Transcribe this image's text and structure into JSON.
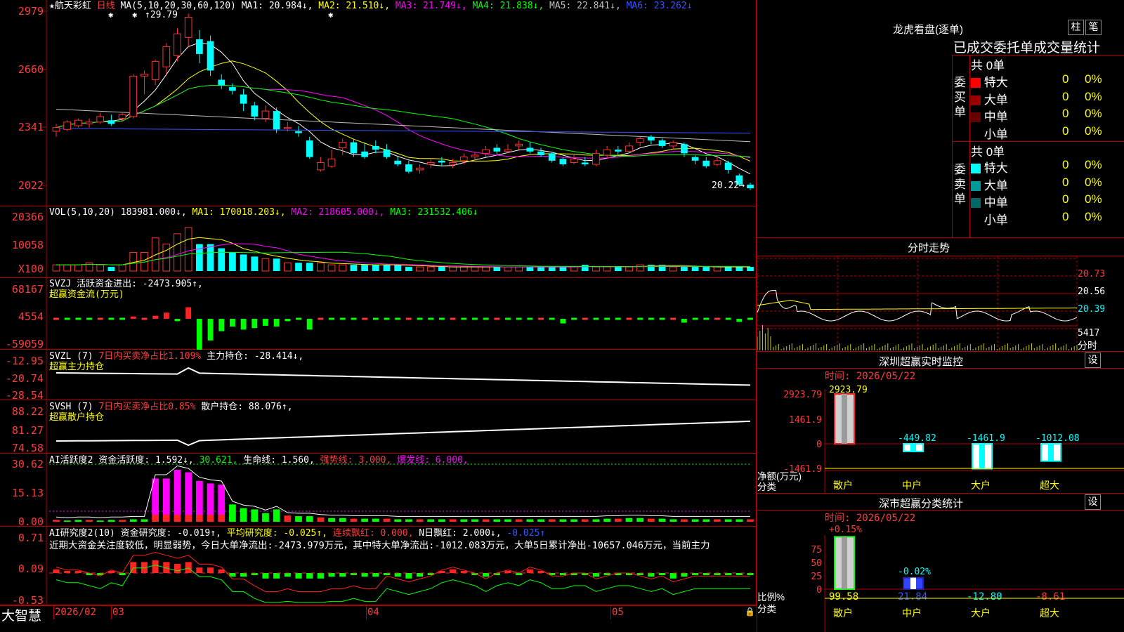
{
  "stock": {
    "star": "★",
    "name": "航天彩虹",
    "period": "日线"
  },
  "main_panel": {
    "ma_params": "MA(5,10,20,30,60,120)",
    "ma_values": [
      {
        "label": "MA1: 20.984↓,",
        "color": "#ffffff"
      },
      {
        "label": "MA2: 21.510↓,",
        "color": "#ffff00"
      },
      {
        "label": "MA3: 21.749↓,",
        "color": "#ff00ff"
      },
      {
        "label": "MA4: 21.838↓,",
        "color": "#00ff00"
      },
      {
        "label": "MA5: 22.841↓,",
        "color": "#c0c0c0"
      },
      {
        "label": "MA6: 23.262↓",
        "color": "#3355ff"
      }
    ],
    "high_label": "29.79",
    "low_label": "20.22",
    "y_ticks": [
      "2979",
      "2660",
      "2341",
      "2022"
    ]
  },
  "vol_panel": {
    "title": "VOL(5,10,20)",
    "value": "183981.000↓,",
    "ma1": "MA1: 170018.203↓,",
    "ma2": "MA2: 218605.000↓,",
    "ma3": "MA3: 231532.406↓",
    "y_ticks": [
      "20366",
      "10058"
    ],
    "unit": "X100"
  },
  "svzj_panel": {
    "title": "SVZJ  活跃资金进出: -2473.905↑,",
    "subtitle": "超赢资金流(万元)",
    "y_ticks": [
      "68167",
      "4554",
      "-59059"
    ]
  },
  "svzl_panel": {
    "prefix": "SVZL (7)",
    "ratio": "7日内买卖净占比1.109%",
    "hold": "主力持仓: -28.414↓,",
    "subtitle": "超赢主力持仓",
    "y_ticks": [
      "-12.95",
      "-20.74",
      "-28.54"
    ]
  },
  "svsh_panel": {
    "prefix": "SVSH (7)",
    "ratio": "7日内买卖净占比0.85%",
    "hold": "散户持仓: 88.076↑,",
    "subtitle": "超赢散户持仓",
    "y_ticks": [
      "88.22",
      "81.27",
      "74.58"
    ]
  },
  "ai_active_panel": {
    "prefix": "AI活跃度2",
    "activity": "资金活跃度: 1.592↓,",
    "v2": "30.621,",
    "life": "生命线: 1.560,",
    "strong": "强势线: 3.000,",
    "burst": "爆发线: 6.000,",
    "y_ticks": [
      "30.62",
      "15.13",
      "0.00"
    ]
  },
  "ai_research_panel": {
    "prefix": "AI研究度2(10)",
    "research": "资金研究度: -0.019↑,",
    "avg": "平均研究度: -0.025↑,",
    "red1": "连续飘红: 0.000,",
    "red2": "N日飘红: 2.000↓,",
    "last": "-0.025↑",
    "text": "近期大资金关注度较低，明显弱势，今日大单净流出:-2473.979万元，其中特大单净流出:-1012.083万元，大单5日累计净出-10657.046万元，当前主力",
    "y_ticks": [
      "0.71",
      "0.09",
      "-0.53"
    ]
  },
  "x_axis": {
    "labels": [
      "2026/02",
      "03",
      "04",
      "05"
    ]
  },
  "brand": "大智慧",
  "right": {
    "dragon_title": "龙虎看盘(逐单)",
    "btn_zhu": "柱",
    "btn_bi": "笔",
    "stats_title": "已成交委托单成交量统计",
    "buy_label": "委买单",
    "sell_label": "委卖单",
    "buy_total": "共 0单",
    "sell_total": "共 0单",
    "buy_rows": [
      {
        "name": "特大",
        "count": "0",
        "pct": "0%",
        "color": "#ff0000"
      },
      {
        "name": "大单",
        "count": "0",
        "pct": "0%",
        "color": "#990000"
      },
      {
        "name": "中单",
        "count": "0",
        "pct": "0%",
        "color": "#660000"
      },
      {
        "name": "小单",
        "count": "0",
        "pct": "0%",
        "color": "#000000"
      }
    ],
    "sell_rows": [
      {
        "name": "特大",
        "count": "0",
        "pct": "0%",
        "color": "#00ffff"
      },
      {
        "name": "大单",
        "count": "0",
        "pct": "0%",
        "color": "#009999"
      },
      {
        "name": "中单",
        "count": "0",
        "pct": "0%",
        "color": "#006666"
      },
      {
        "name": "小单",
        "count": "0",
        "pct": "0%",
        "color": "#000000"
      }
    ],
    "intraday_title": "分时走势",
    "intraday_ticks": [
      "20.73",
      "20.56",
      "20.39"
    ],
    "intraday_vol": "5417",
    "intraday_label": "分时",
    "monitor_title": "深圳超赢实时监控",
    "monitor_btn": "设",
    "monitor_time": "时间: 2026/05/22",
    "monitor_y": [
      "2923.79",
      "1461.9",
      "0",
      "-1461.9"
    ],
    "monitor_axis_label": "净额(万元)",
    "monitor_axis_cat": "分类",
    "monitor_bars": [
      {
        "cat": "散户",
        "value": 2923.79,
        "label": "2923.79"
      },
      {
        "cat": "中户",
        "value": -449.82,
        "label": "-449.82"
      },
      {
        "cat": "大户",
        "value": -1461.9,
        "label": "-1461.9"
      },
      {
        "cat": "超大",
        "value": -1012.08,
        "label": "-1012.08"
      }
    ],
    "class_title": "深市超赢分类统计",
    "class_btn": "设",
    "class_time": "时间: 2026/05/22",
    "class_y": [
      "75",
      "50",
      "25",
      "0"
    ],
    "class_axis_label": "比例%",
    "class_axis_cat": "分类",
    "class_top_labels": [
      "+0.15%",
      "-0.02%"
    ],
    "class_bars": [
      {
        "cat": "散户",
        "pct": 99.58,
        "label": "99.58"
      },
      {
        "cat": "中户",
        "pct": 21.84,
        "label": "21.84"
      },
      {
        "cat": "大户",
        "pct": -12.8,
        "label": "-12.80"
      },
      {
        "cat": "超大",
        "pct": -8.61,
        "label": "-8.61"
      }
    ]
  },
  "chart_data": {
    "type": "candlestick",
    "title": "航天彩虹 日线",
    "ylim": [
      20.22,
      29.79
    ],
    "candles": [
      [
        23.4,
        23.6,
        23.1,
        23.8
      ],
      [
        23.5,
        23.9,
        23.4,
        24.0
      ],
      [
        23.7,
        24.0,
        23.6,
        24.1
      ],
      [
        23.8,
        23.9,
        23.6,
        24.1
      ],
      [
        23.9,
        24.2,
        23.8,
        24.4
      ],
      [
        24.0,
        23.8,
        23.7,
        24.3
      ],
      [
        24.1,
        24.3,
        23.9,
        24.4
      ],
      [
        24.2,
        26.4,
        24.1,
        26.5
      ],
      [
        26.4,
        26.5,
        25.4,
        26.7
      ],
      [
        26.2,
        27.2,
        25.9,
        27.3
      ],
      [
        26.9,
        28.0,
        26.5,
        28.2
      ],
      [
        27.5,
        28.7,
        27.2,
        29.0
      ],
      [
        28.5,
        29.6,
        28.0,
        29.8
      ],
      [
        28.4,
        27.6,
        27.1,
        28.9
      ],
      [
        28.3,
        26.7,
        26.4,
        28.6
      ],
      [
        26.2,
        25.9,
        25.7,
        26.5
      ],
      [
        25.8,
        25.6,
        25.4,
        26.0
      ],
      [
        25.4,
        24.9,
        24.5,
        25.7
      ],
      [
        24.8,
        24.2,
        24.0,
        25.0
      ],
      [
        24.1,
        24.5,
        23.9,
        24.8
      ],
      [
        24.5,
        23.5,
        23.3,
        24.7
      ],
      [
        23.6,
        23.6,
        23.4,
        23.9
      ],
      [
        23.4,
        23.3,
        23.1,
        23.7
      ],
      [
        22.9,
        22.0,
        21.9,
        23.1
      ],
      [
        21.3,
        21.7,
        21.2,
        22.0
      ],
      [
        21.5,
        21.9,
        21.4,
        22.4
      ],
      [
        22.5,
        22.8,
        22.1,
        23.0
      ],
      [
        22.8,
        22.2,
        22.0,
        23.0
      ],
      [
        22.3,
        22.0,
        21.9,
        22.8
      ],
      [
        22.6,
        22.4,
        22.2,
        22.9
      ],
      [
        22.4,
        22.0,
        21.9,
        22.7
      ],
      [
        21.8,
        21.6,
        21.5,
        22.0
      ],
      [
        21.6,
        21.2,
        21.1,
        21.8
      ],
      [
        21.3,
        21.4,
        21.1,
        21.6
      ],
      [
        21.6,
        21.7,
        21.4,
        21.9
      ],
      [
        21.8,
        21.7,
        21.5,
        22.0
      ],
      [
        21.6,
        21.7,
        21.4,
        21.9
      ],
      [
        21.8,
        22.0,
        21.6,
        22.2
      ],
      [
        22.0,
        22.1,
        21.8,
        22.3
      ],
      [
        22.2,
        22.4,
        22.0,
        22.6
      ],
      [
        22.5,
        22.3,
        22.1,
        22.7
      ],
      [
        22.3,
        22.4,
        22.2,
        22.7
      ],
      [
        22.6,
        22.7,
        22.4,
        22.9
      ],
      [
        22.5,
        22.3,
        22.2,
        22.8
      ],
      [
        22.3,
        22.1,
        22.0,
        22.5
      ],
      [
        22.2,
        21.8,
        21.7,
        22.3
      ],
      [
        21.9,
        21.6,
        21.5,
        22.0
      ],
      [
        21.7,
        21.9,
        21.6,
        22.1
      ],
      [
        21.7,
        21.6,
        21.5,
        22.0
      ],
      [
        21.6,
        22.2,
        21.5,
        22.4
      ],
      [
        22.1,
        22.4,
        21.9,
        22.6
      ],
      [
        22.4,
        22.3,
        22.1,
        22.6
      ],
      [
        22.3,
        22.6,
        22.2,
        22.8
      ],
      [
        22.8,
        23.0,
        22.6,
        23.1
      ],
      [
        23.1,
        22.9,
        22.7,
        23.2
      ],
      [
        22.9,
        22.6,
        22.5,
        23.0
      ],
      [
        22.6,
        22.8,
        22.4,
        22.9
      ],
      [
        22.7,
        22.2,
        22.0,
        22.8
      ],
      [
        22.0,
        21.8,
        21.6,
        22.1
      ],
      [
        21.8,
        21.5,
        21.4,
        22.0
      ],
      [
        21.6,
        21.8,
        21.5,
        22.0
      ],
      [
        21.7,
        21.3,
        21.1,
        21.8
      ],
      [
        21.0,
        20.5,
        20.4,
        21.1
      ],
      [
        20.5,
        20.3,
        20.2,
        20.6
      ]
    ]
  }
}
